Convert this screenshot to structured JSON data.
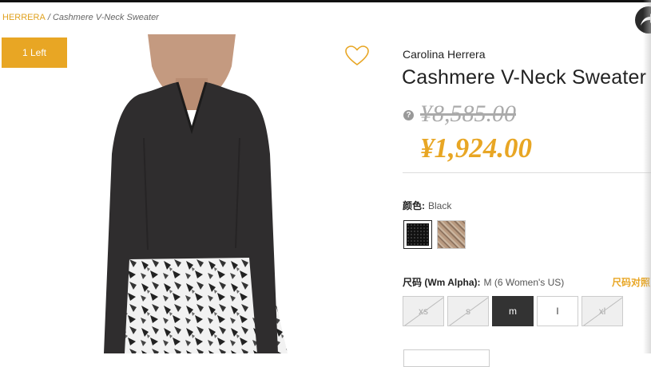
{
  "breadcrumb": {
    "brand": "HERRERA",
    "separator": "/",
    "product": "Cashmere V-Neck Sweater"
  },
  "badge": {
    "stock": "1 Left"
  },
  "product": {
    "brand": "Carolina Herrera",
    "title": "Cashmere V-Neck Sweater",
    "original_price": "¥8,585.00",
    "sale_price": "¥1,924.00"
  },
  "color": {
    "label": "颜色:",
    "selected": "Black",
    "swatches": [
      {
        "name": "black",
        "hex": "#111111"
      },
      {
        "name": "tan-pattern",
        "hex": "#b99a80"
      }
    ]
  },
  "size": {
    "label": "尺码 (Wm Alpha):",
    "selected": "M (6 Women's US)",
    "guide_link": "尺码对照",
    "options": [
      {
        "label": "xs",
        "state": "unavailable"
      },
      {
        "label": "s",
        "state": "unavailable"
      },
      {
        "label": "m",
        "state": "selected"
      },
      {
        "label": "l",
        "state": "available"
      },
      {
        "label": "xl",
        "state": "unavailable"
      }
    ]
  },
  "colors": {
    "accent": "#e8a624",
    "text": "#222222",
    "muted": "#aaaaaa"
  },
  "icons": {
    "favorite": "heart-icon",
    "help": "question-icon",
    "floating": "share-arrow-icon"
  }
}
